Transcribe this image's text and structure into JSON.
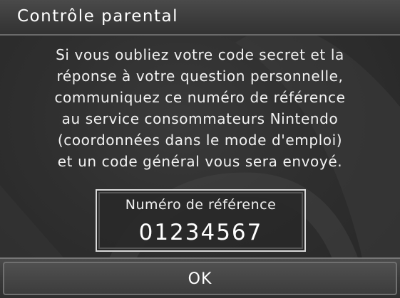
{
  "dialog": {
    "title": "Contrôle parental",
    "message_lines": [
      "Si vous oubliez votre code secret et la",
      "réponse à votre question personnelle,",
      "communiquez ce numéro de référence",
      "au service consommateurs Nintendo",
      "(coordonnées dans le mode d'emploi)",
      "et un code général vous sera envoyé."
    ]
  },
  "reference": {
    "label": "Numéro de référence",
    "number": "01234567"
  },
  "buttons": {
    "ok_label": "OK"
  },
  "colors": {
    "background": "#2e2e2e",
    "text": "#f4f4f4",
    "box_border": "#d8d8d8"
  }
}
